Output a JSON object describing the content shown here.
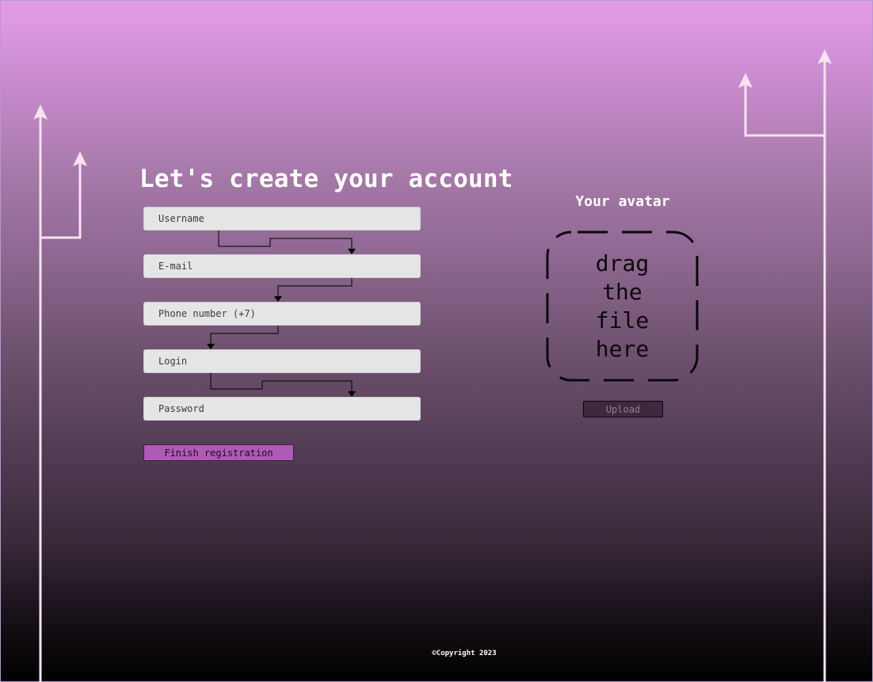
{
  "page": {
    "title": "Let's create your account"
  },
  "form": {
    "username_placeholder": "Username",
    "email_placeholder": "E-mail",
    "phone_placeholder": "Phone number (+7)",
    "login_placeholder": "Login",
    "password_placeholder": "Password",
    "submit_label": "Finish registration"
  },
  "avatar": {
    "title": "Your avatar",
    "drop_text": [
      "drag",
      "the",
      "file",
      "here"
    ],
    "upload_label": "Upload"
  },
  "footer": {
    "copyright": "©Copyright 2023"
  },
  "colors": {
    "gradient_top": "#e09ce5",
    "gradient_bottom": "#000000",
    "field_bg": "#e6e5e6",
    "submit_bg": "#b05ab8",
    "upload_bg": "#3e2a3f",
    "decor_lines": "#f7e3f0"
  }
}
